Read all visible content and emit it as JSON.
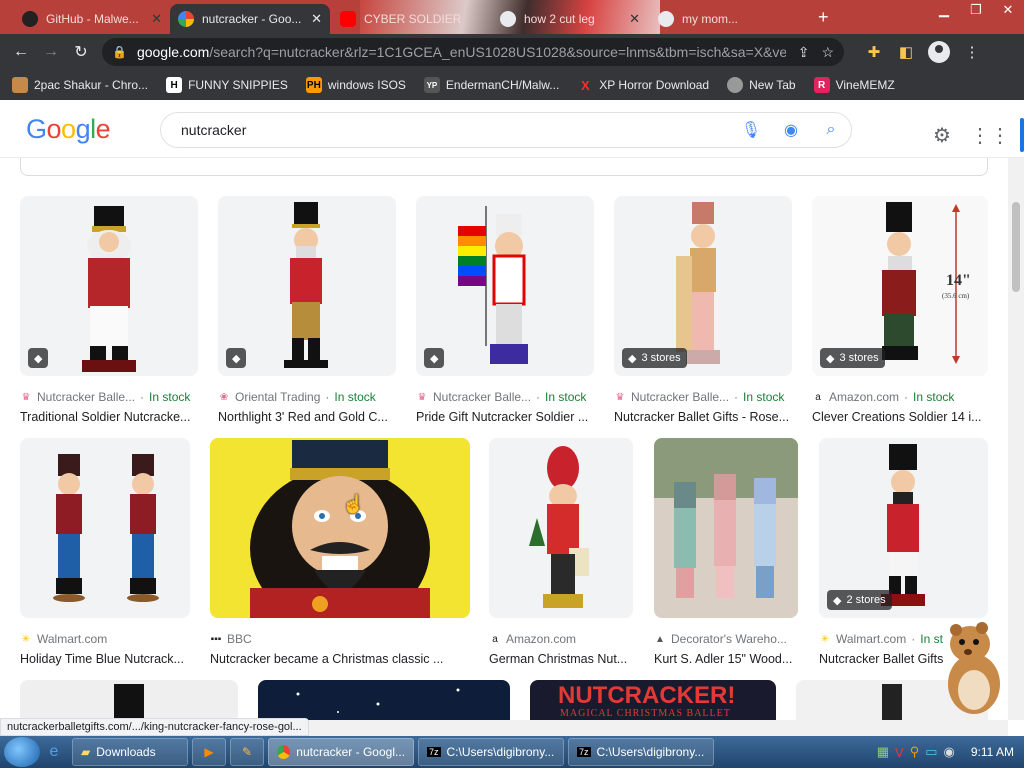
{
  "browser": {
    "tabs": [
      {
        "label": "GitHub - Malwe...",
        "color": "#333"
      },
      {
        "label": "nutcracker - Goo...",
        "color": "#4285f4"
      },
      {
        "label": "CYBER SOLDIER",
        "color": "#ff0000"
      },
      {
        "label": "how 2 cut leg",
        "color": "#4285f4"
      },
      {
        "label": "my mom...",
        "color": "#4285f4"
      }
    ],
    "url_domain": "google.com",
    "url_rest": "/search?q=nutcracker&rlz=1C1GCEA_enUS1028US1028&source=lnms&tbm=isch&sa=X&ved=...",
    "bookmarks": [
      {
        "label": "2pac Shakur - Chro...",
        "icon": "person-icon",
        "badge": "",
        "color": "#c58a4a"
      },
      {
        "label": "FUNNY SNIPPIES",
        "icon": "h-icon",
        "badge": "H",
        "color": "#ffffff"
      },
      {
        "label": "windows ISOS",
        "icon": "ph-icon",
        "badge": "PH",
        "color": "#f90"
      },
      {
        "label": "EndermanCH/Malw...",
        "icon": "yp-icon",
        "badge": "YP",
        "color": "#555"
      },
      {
        "label": "XP Horror Download",
        "icon": "x-icon",
        "badge": "X",
        "color": "#d00"
      },
      {
        "label": "New Tab",
        "icon": "globe-icon",
        "badge": "",
        "color": "#999"
      },
      {
        "label": "VineMEMZ",
        "icon": "r-icon",
        "badge": "R",
        "color": "#e0245e"
      }
    ]
  },
  "search": {
    "logo": "Google",
    "query": "nutcracker"
  },
  "results": [
    {
      "source": "Nutcracker Balle...",
      "stock": "In stock",
      "title": "Traditional Soldier Nutcracke...",
      "tag": "",
      "source_color": "#e06b8a"
    },
    {
      "source": "Oriental Trading",
      "stock": "In stock",
      "title": "Northlight 3' Red and Gold C...",
      "tag": "",
      "source_color": "#e06b8a"
    },
    {
      "source": "Nutcracker Balle...",
      "stock": "In stock",
      "title": "Pride Gift Nutcracker Soldier ...",
      "tag": "",
      "source_color": "#e06b8a"
    },
    {
      "source": "Nutcracker Balle...",
      "stock": "In stock",
      "title": "Nutcracker Ballet Gifts - Rose...",
      "tag": "3 stores",
      "source_color": "#e06b8a"
    },
    {
      "source": "Amazon.com",
      "stock": "In stock",
      "title": "Clever Creations Soldier 14 i...",
      "tag": "3 stores",
      "source_color": "#222"
    },
    {
      "source": "Walmart.com",
      "stock": "",
      "title": "Holiday Time Blue Nutcrack...",
      "tag": "",
      "source_color": "#fbbc04"
    },
    {
      "source": "BBC",
      "stock": "",
      "title": "Nutcracker became a Christmas classic ...",
      "tag": "",
      "source_color": "#222"
    },
    {
      "source": "Amazon.com",
      "stock": "",
      "title": "German Christmas Nut...",
      "tag": "",
      "source_color": "#222"
    },
    {
      "source": "Decorator's Wareho...",
      "stock": "",
      "title": "Kurt S. Adler 15\" Wood...",
      "tag": "",
      "source_color": "#555"
    },
    {
      "source": "Walmart.com",
      "stock": "In st",
      "title": "Nutcracker Ballet Gifts",
      "tag": "2 stores",
      "source_color": "#fbbc04"
    }
  ],
  "image_text": {
    "size_label": "14\"",
    "size_sub": "(35.6 cm)",
    "banner_main": "NUTCRACKER!",
    "banner_sub": "MAGICAL CHRISTMAS BALLET"
  },
  "status_url": "nutcrackerballetgifts.com/.../king-nutcracker-fancy-rose-gol...",
  "taskbar": {
    "buttons": [
      {
        "label": "Downloads",
        "icon": "folder-icon"
      },
      {
        "label": "",
        "icon": "media-player-icon"
      },
      {
        "label": "",
        "icon": "paint-icon"
      },
      {
        "label": "nutcracker - Googl...",
        "icon": "chrome-icon"
      },
      {
        "label": "C:\\Users\\digibrony...",
        "icon": "7zip-icon"
      },
      {
        "label": "C:\\Users\\digibrony...",
        "icon": "7zip-icon"
      }
    ],
    "clock": "9:11 AM"
  },
  "colors": {
    "accent": "#1a73e8",
    "stock_green": "#188038",
    "chrome_dark": "#35363a"
  }
}
